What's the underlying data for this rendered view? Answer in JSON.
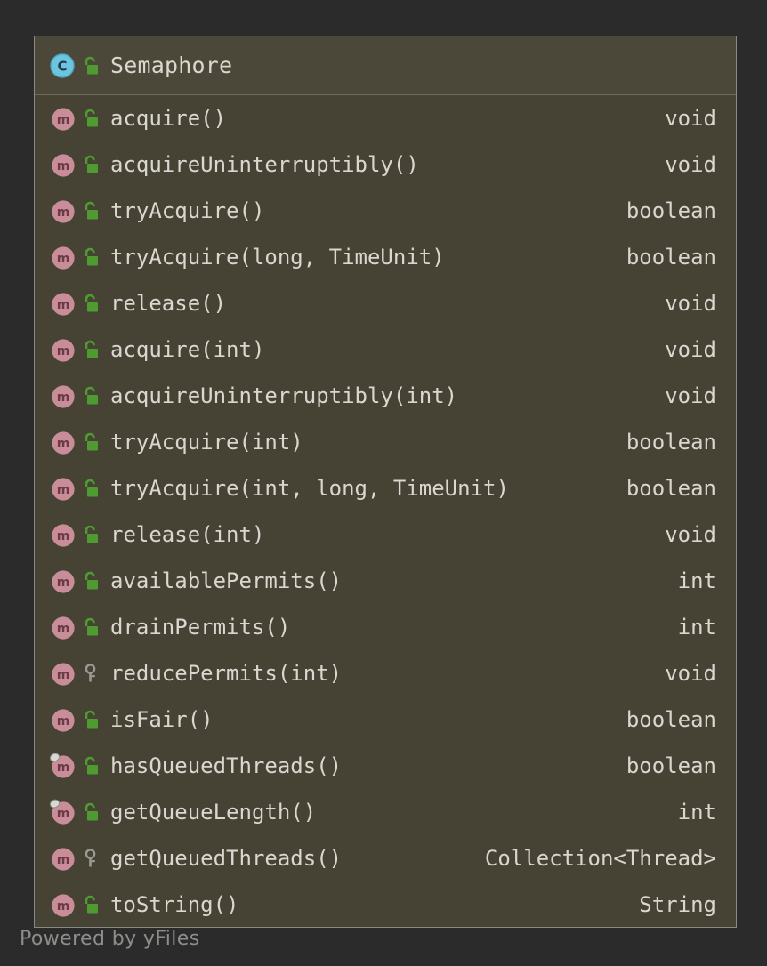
{
  "node": {
    "header": {
      "kind_icon": "class-icon",
      "kind_letter": "C",
      "visibility_icon": "public-unlocked-padlock-icon",
      "title": "Semaphore"
    },
    "members": [
      {
        "kind_icon": "method-icon",
        "visibility_icon": "public-unlocked-padlock-icon",
        "name": "acquire()",
        "return_type": "void",
        "badge": false
      },
      {
        "kind_icon": "method-icon",
        "visibility_icon": "public-unlocked-padlock-icon",
        "name": "acquireUninterruptibly()",
        "return_type": "void",
        "badge": false
      },
      {
        "kind_icon": "method-icon",
        "visibility_icon": "public-unlocked-padlock-icon",
        "name": "tryAcquire()",
        "return_type": "boolean",
        "badge": false
      },
      {
        "kind_icon": "method-icon",
        "visibility_icon": "public-unlocked-padlock-icon",
        "name": "tryAcquire(long, TimeUnit)",
        "return_type": "boolean",
        "badge": false
      },
      {
        "kind_icon": "method-icon",
        "visibility_icon": "public-unlocked-padlock-icon",
        "name": "release()",
        "return_type": "void",
        "badge": false
      },
      {
        "kind_icon": "method-icon",
        "visibility_icon": "public-unlocked-padlock-icon",
        "name": "acquire(int)",
        "return_type": "void",
        "badge": false
      },
      {
        "kind_icon": "method-icon",
        "visibility_icon": "public-unlocked-padlock-icon",
        "name": "acquireUninterruptibly(int)",
        "return_type": "void",
        "badge": false
      },
      {
        "kind_icon": "method-icon",
        "visibility_icon": "public-unlocked-padlock-icon",
        "name": "tryAcquire(int)",
        "return_type": "boolean",
        "badge": false
      },
      {
        "kind_icon": "method-icon",
        "visibility_icon": "public-unlocked-padlock-icon",
        "name": "tryAcquire(int, long, TimeUnit)",
        "return_type": "boolean",
        "badge": false
      },
      {
        "kind_icon": "method-icon",
        "visibility_icon": "public-unlocked-padlock-icon",
        "name": "release(int)",
        "return_type": "void",
        "badge": false
      },
      {
        "kind_icon": "method-icon",
        "visibility_icon": "public-unlocked-padlock-icon",
        "name": "availablePermits()",
        "return_type": "int",
        "badge": false
      },
      {
        "kind_icon": "method-icon",
        "visibility_icon": "public-unlocked-padlock-icon",
        "name": "drainPermits()",
        "return_type": "int",
        "badge": false
      },
      {
        "kind_icon": "method-icon",
        "visibility_icon": "protected-key-icon",
        "name": "reducePermits(int)",
        "return_type": "void",
        "badge": false
      },
      {
        "kind_icon": "method-icon",
        "visibility_icon": "public-unlocked-padlock-icon",
        "name": "isFair()",
        "return_type": "boolean",
        "badge": false
      },
      {
        "kind_icon": "method-icon",
        "visibility_icon": "public-unlocked-padlock-icon",
        "name": "hasQueuedThreads()",
        "return_type": "boolean",
        "badge": true
      },
      {
        "kind_icon": "method-icon",
        "visibility_icon": "public-unlocked-padlock-icon",
        "name": "getQueueLength()",
        "return_type": "int",
        "badge": true
      },
      {
        "kind_icon": "method-icon",
        "visibility_icon": "protected-key-icon",
        "name": "getQueuedThreads()",
        "return_type": "Collection<Thread>",
        "badge": false
      },
      {
        "kind_icon": "method-icon",
        "visibility_icon": "public-unlocked-padlock-icon",
        "name": "toString()",
        "return_type": "String",
        "badge": false
      }
    ]
  },
  "watermark": "Powered by yFiles",
  "colors": {
    "canvas_background": "#2b2b2b",
    "node_header_background": "#4c4839",
    "node_body_background": "#464335",
    "node_border": "#8a8a85",
    "text": "#d9d7cf",
    "class_icon": "#6cc4dd",
    "class_icon_letter": "#1d3a52",
    "method_icon": "#c98d9a",
    "method_icon_letter": "#6b3a45",
    "public_padlock": "#4f9b32",
    "protected_key": "#9a9a95",
    "watermark_text": "#8d8d8a"
  }
}
